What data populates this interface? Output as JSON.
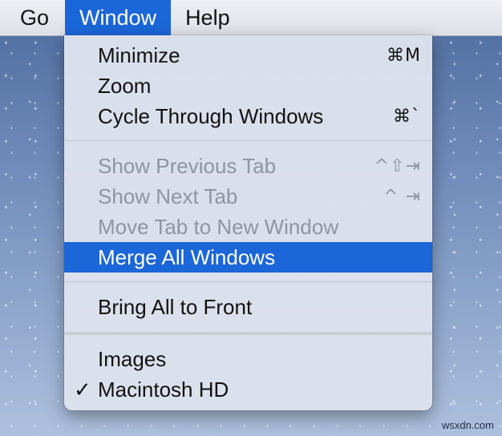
{
  "menubar": {
    "items": [
      "Go",
      "Window",
      "Help"
    ]
  },
  "window_menu": {
    "items": [
      {
        "label": "Minimize",
        "shortcut": "⌘M"
      },
      {
        "label": "Zoom",
        "shortcut": ""
      },
      {
        "label": "Cycle Through Windows",
        "shortcut": "⌘`"
      },
      {
        "label": "Show Previous Tab",
        "shortcut": "^⇧⇥"
      },
      {
        "label": "Show Next Tab",
        "shortcut": "^ ⇥"
      },
      {
        "label": "Move Tab to New Window",
        "shortcut": ""
      },
      {
        "label": "Merge All Windows",
        "shortcut": ""
      },
      {
        "label": "Bring All to Front",
        "shortcut": ""
      },
      {
        "label": "Images",
        "shortcut": ""
      },
      {
        "label": "Macintosh HD",
        "check": "✓"
      }
    ]
  },
  "colors": {
    "highlight": "#1b66d8",
    "disabled_text": "#8e95a2",
    "menu_background": "#dde2ec"
  },
  "watermark": "wsxdn.com"
}
